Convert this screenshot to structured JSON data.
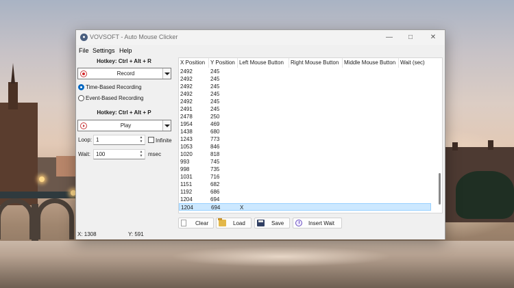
{
  "window": {
    "title": "VOVSOFT - Auto Mouse Clicker",
    "icon": "mouse-app-icon"
  },
  "menu": [
    "File",
    "Settings",
    "Help"
  ],
  "recording": {
    "hotkey_label": "Hotkey: Ctrl + Alt + R",
    "record_label": "Record",
    "modes": [
      {
        "label": "Time-Based Recording",
        "checked": true
      },
      {
        "label": "Event-Based Recording",
        "checked": false
      }
    ]
  },
  "playback": {
    "hotkey_label": "Hotkey: Ctrl + Alt + P",
    "play_label": "Play",
    "loop_label": "Loop:",
    "loop_value": "1",
    "infinite_label": "Infinite",
    "infinite_checked": false,
    "wait_label": "Wait:",
    "wait_value": "100",
    "wait_unit": "msec"
  },
  "table": {
    "columns": [
      "X Position",
      "Y Position",
      "Left Mouse Button",
      "Right Mouse Button",
      "Middle Mouse Button",
      "Wait (sec)"
    ],
    "rows": [
      [
        "2492",
        "245",
        "",
        "",
        "",
        ""
      ],
      [
        "2492",
        "245",
        "",
        "",
        "",
        ""
      ],
      [
        "2492",
        "245",
        "",
        "",
        "",
        ""
      ],
      [
        "2492",
        "245",
        "",
        "",
        "",
        ""
      ],
      [
        "2492",
        "245",
        "",
        "",
        "",
        ""
      ],
      [
        "2491",
        "245",
        "",
        "",
        "",
        ""
      ],
      [
        "2478",
        "250",
        "",
        "",
        "",
        ""
      ],
      [
        "1954",
        "469",
        "",
        "",
        "",
        ""
      ],
      [
        "1438",
        "680",
        "",
        "",
        "",
        ""
      ],
      [
        "1243",
        "773",
        "",
        "",
        "",
        ""
      ],
      [
        "1053",
        "846",
        "",
        "",
        "",
        ""
      ],
      [
        "1020",
        "818",
        "",
        "",
        "",
        ""
      ],
      [
        "993",
        "745",
        "",
        "",
        "",
        ""
      ],
      [
        "998",
        "735",
        "",
        "",
        "",
        ""
      ],
      [
        "1031",
        "716",
        "",
        "",
        "",
        ""
      ],
      [
        "1151",
        "682",
        "",
        "",
        "",
        ""
      ],
      [
        "1192",
        "686",
        "",
        "",
        "",
        ""
      ],
      [
        "1204",
        "694",
        "",
        "",
        "",
        ""
      ],
      [
        "1204",
        "694",
        "X",
        "",
        "",
        ""
      ]
    ],
    "selected_row": 18
  },
  "buttons": {
    "clear": "Clear",
    "load": "Load",
    "save": "Save",
    "insert_wait": "Insert Wait"
  },
  "status": {
    "x": "X: 1308",
    "y": "Y: 591"
  },
  "colors": {
    "accent": "#0067c0",
    "selection": "#cce8ff",
    "record": "#d7262a"
  }
}
